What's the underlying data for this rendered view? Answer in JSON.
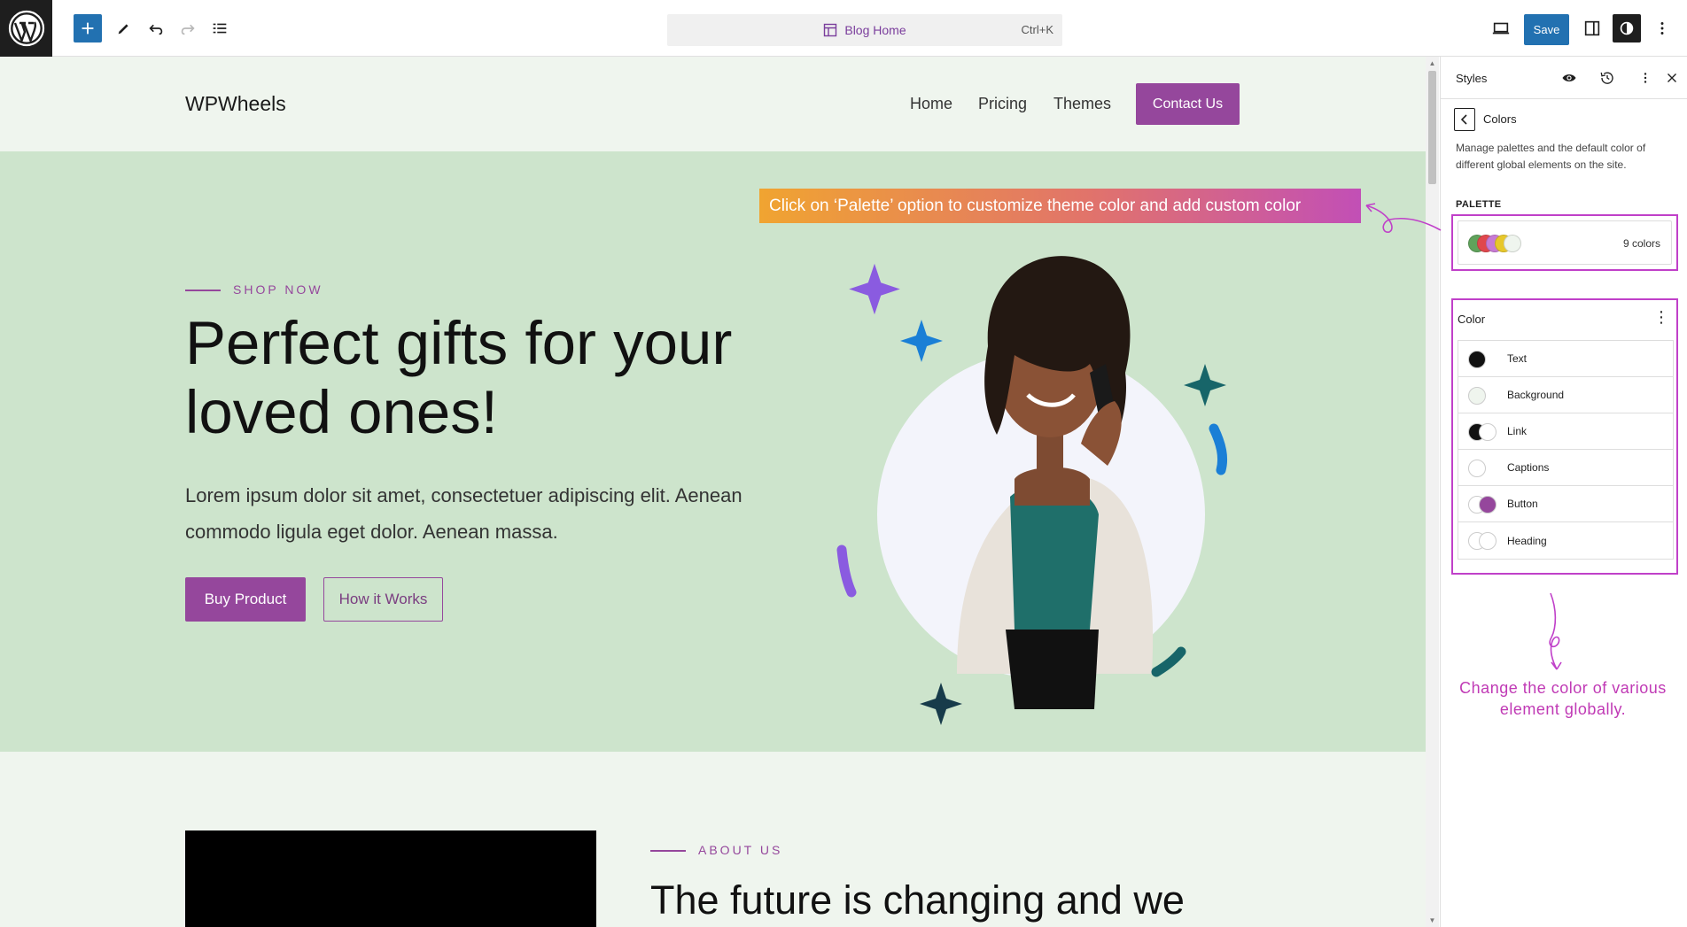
{
  "toolbar": {
    "document_title": "Blog Home",
    "shortcut": "Ctrl+K",
    "save_label": "Save"
  },
  "site": {
    "title": "WPWheels",
    "nav": [
      "Home",
      "Pricing",
      "Themes"
    ],
    "contact_label": "Contact Us"
  },
  "hero": {
    "kicker": "SHOP NOW",
    "title": "Perfect gifts for your loved ones!",
    "text": "Lorem ipsum dolor sit amet, consectetuer adipiscing elit. Aenean commodo ligula eget dolor. Aenean massa.",
    "buy_label": "Buy Product",
    "how_label": "How it Works"
  },
  "callout": {
    "text": "Click on ‘Palette’ option to customize theme color and add custom color"
  },
  "about": {
    "kicker": "ABOUT US",
    "title": "The future is changing and we"
  },
  "sidebar": {
    "title": "Styles",
    "section": "Colors",
    "description": "Manage palettes and the default color of different global elements on the site.",
    "palette_label": "PALETTE",
    "palette_count": "9 colors",
    "palette_swatches": [
      "#5fa25b",
      "#e0474c",
      "#c77ad4",
      "#e7c72a",
      "#eff5ee"
    ],
    "color_label": "Color",
    "color_items": [
      {
        "label": "Text",
        "swatch": "#111111"
      },
      {
        "label": "Background",
        "swatch": "#eff5ee"
      },
      {
        "label": "Link",
        "swatch": "#111111"
      },
      {
        "label": "Captions",
        "swatch": "#ffffff"
      },
      {
        "label": "Button",
        "swatch": "#95479c"
      },
      {
        "label": "Heading",
        "swatch": "#ffffff"
      }
    ]
  },
  "note": {
    "text": "Change the color of various element globally."
  },
  "colors": {
    "accent": "#95479c",
    "hero_bg": "#cde4cc",
    "page_bg": "#eff5ee",
    "wp_blue": "#2271b1",
    "annotation": "#c040c9"
  }
}
